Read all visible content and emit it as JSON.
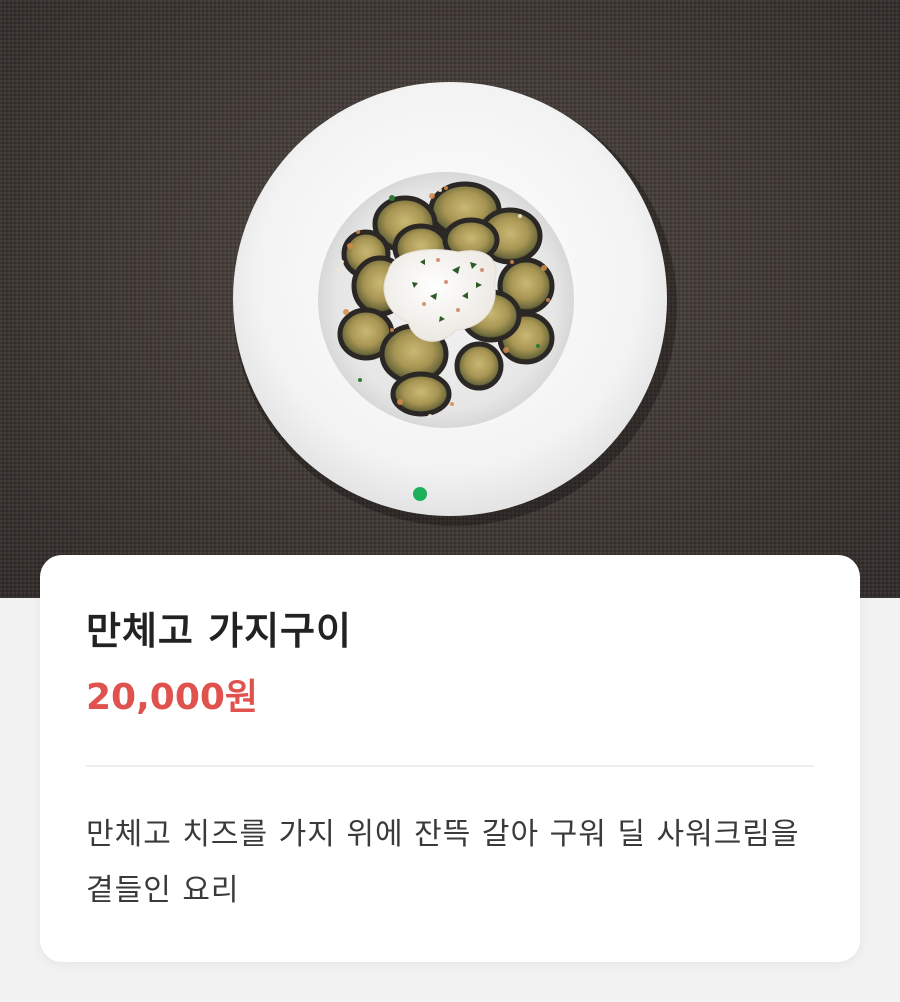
{
  "product": {
    "name": "만체고 가지구이",
    "price": "20,000원",
    "description": "만체고 치즈를 가지 위에 잔뜩 갈아 구워 딜 사워크림을 곁들인 요리",
    "image_alt": "만체고 가지구이"
  },
  "carousel": {
    "total": 1,
    "active_index": 0
  },
  "colors": {
    "price": "#e0524e",
    "indicator": "#1db05a",
    "background": "#f2f2f2",
    "tablecloth": "#3d3632"
  },
  "icons": {
    "carousel_indicator": "dot-indicator-icon"
  }
}
